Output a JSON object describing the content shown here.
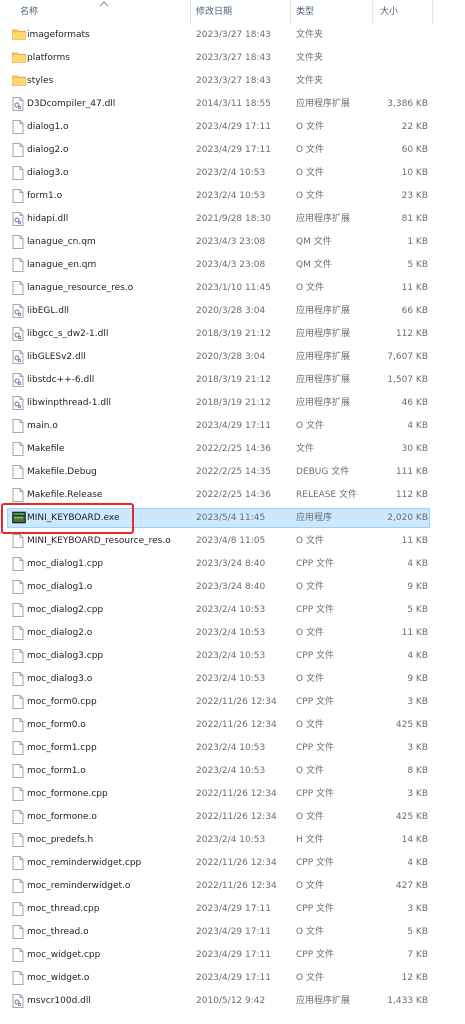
{
  "header": {
    "col_name": "名称",
    "col_date": "修改日期",
    "col_type": "类型",
    "col_size": "大小"
  },
  "files": [
    {
      "name": "imageformats",
      "date": "2023/3/27 18:43",
      "type": "文件夹",
      "size": "",
      "icon": "folder-icon"
    },
    {
      "name": "platforms",
      "date": "2023/3/27 18:43",
      "type": "文件夹",
      "size": "",
      "icon": "folder-icon"
    },
    {
      "name": "styles",
      "date": "2023/3/27 18:43",
      "type": "文件夹",
      "size": "",
      "icon": "folder-icon"
    },
    {
      "name": "D3Dcompiler_47.dll",
      "date": "2014/3/11 18:55",
      "type": "应用程序扩展",
      "size": "3,386 KB",
      "icon": "dll-icon"
    },
    {
      "name": "dialog1.o",
      "date": "2023/4/29 17:11",
      "type": "O 文件",
      "size": "22 KB",
      "icon": "file-icon"
    },
    {
      "name": "dialog2.o",
      "date": "2023/4/29 17:11",
      "type": "O 文件",
      "size": "60 KB",
      "icon": "file-icon"
    },
    {
      "name": "dialog3.o",
      "date": "2023/2/4 10:53",
      "type": "O 文件",
      "size": "10 KB",
      "icon": "file-icon"
    },
    {
      "name": "form1.o",
      "date": "2023/2/4 10:53",
      "type": "O 文件",
      "size": "23 KB",
      "icon": "file-icon"
    },
    {
      "name": "hidapi.dll",
      "date": "2021/9/28 18:30",
      "type": "应用程序扩展",
      "size": "81 KB",
      "icon": "dll-icon"
    },
    {
      "name": "lanague_cn.qm",
      "date": "2023/4/3 23:08",
      "type": "QM 文件",
      "size": "1 KB",
      "icon": "file-icon"
    },
    {
      "name": "lanague_en.qm",
      "date": "2023/4/3 23:08",
      "type": "QM 文件",
      "size": "5 KB",
      "icon": "file-icon"
    },
    {
      "name": "lanague_resource_res.o",
      "date": "2023/1/10 11:45",
      "type": "O 文件",
      "size": "11 KB",
      "icon": "file-icon"
    },
    {
      "name": "libEGL.dll",
      "date": "2020/3/28 3:04",
      "type": "应用程序扩展",
      "size": "66 KB",
      "icon": "dll-icon"
    },
    {
      "name": "libgcc_s_dw2-1.dll",
      "date": "2018/3/19 21:12",
      "type": "应用程序扩展",
      "size": "112 KB",
      "icon": "dll-icon"
    },
    {
      "name": "libGLESv2.dll",
      "date": "2020/3/28 3:04",
      "type": "应用程序扩展",
      "size": "7,607 KB",
      "icon": "dll-icon"
    },
    {
      "name": "libstdc++-6.dll",
      "date": "2018/3/19 21:12",
      "type": "应用程序扩展",
      "size": "1,507 KB",
      "icon": "dll-icon"
    },
    {
      "name": "libwinpthread-1.dll",
      "date": "2018/3/19 21:12",
      "type": "应用程序扩展",
      "size": "46 KB",
      "icon": "dll-icon"
    },
    {
      "name": "main.o",
      "date": "2023/4/29 17:11",
      "type": "O 文件",
      "size": "4 KB",
      "icon": "file-icon"
    },
    {
      "name": "Makefile",
      "date": "2022/2/25 14:36",
      "type": "文件",
      "size": "30 KB",
      "icon": "file-icon"
    },
    {
      "name": "Makefile.Debug",
      "date": "2022/2/25 14:35",
      "type": "DEBUG 文件",
      "size": "111 KB",
      "icon": "file-icon"
    },
    {
      "name": "Makefile.Release",
      "date": "2022/2/25 14:36",
      "type": "RELEASE 文件",
      "size": "112 KB",
      "icon": "file-icon"
    },
    {
      "name": "MINI_KEYBOARD.exe",
      "date": "2023/5/4 11:45",
      "type": "应用程序",
      "size": "2,020 KB",
      "icon": "exe-icon",
      "selected": true
    },
    {
      "name": "MINI_KEYBOARD_resource_res.o",
      "date": "2023/4/8 11:05",
      "type": "O 文件",
      "size": "11 KB",
      "icon": "file-icon"
    },
    {
      "name": "moc_dialog1.cpp",
      "date": "2023/3/24 8:40",
      "type": "CPP 文件",
      "size": "4 KB",
      "icon": "file-icon"
    },
    {
      "name": "moc_dialog1.o",
      "date": "2023/3/24 8:40",
      "type": "O 文件",
      "size": "9 KB",
      "icon": "file-icon"
    },
    {
      "name": "moc_dialog2.cpp",
      "date": "2023/2/4 10:53",
      "type": "CPP 文件",
      "size": "5 KB",
      "icon": "file-icon"
    },
    {
      "name": "moc_dialog2.o",
      "date": "2023/2/4 10:53",
      "type": "O 文件",
      "size": "11 KB",
      "icon": "file-icon"
    },
    {
      "name": "moc_dialog3.cpp",
      "date": "2023/2/4 10:53",
      "type": "CPP 文件",
      "size": "4 KB",
      "icon": "file-icon"
    },
    {
      "name": "moc_dialog3.o",
      "date": "2023/2/4 10:53",
      "type": "O 文件",
      "size": "9 KB",
      "icon": "file-icon"
    },
    {
      "name": "moc_form0.cpp",
      "date": "2022/11/26 12:34",
      "type": "CPP 文件",
      "size": "3 KB",
      "icon": "file-icon"
    },
    {
      "name": "moc_form0.o",
      "date": "2022/11/26 12:34",
      "type": "O 文件",
      "size": "425 KB",
      "icon": "file-icon"
    },
    {
      "name": "moc_form1.cpp",
      "date": "2023/2/4 10:53",
      "type": "CPP 文件",
      "size": "3 KB",
      "icon": "file-icon"
    },
    {
      "name": "moc_form1.o",
      "date": "2023/2/4 10:53",
      "type": "O 文件",
      "size": "8 KB",
      "icon": "file-icon"
    },
    {
      "name": "moc_formone.cpp",
      "date": "2022/11/26 12:34",
      "type": "CPP 文件",
      "size": "3 KB",
      "icon": "file-icon"
    },
    {
      "name": "moc_formone.o",
      "date": "2022/11/26 12:34",
      "type": "O 文件",
      "size": "425 KB",
      "icon": "file-icon"
    },
    {
      "name": "moc_predefs.h",
      "date": "2023/2/4 10:53",
      "type": "H 文件",
      "size": "14 KB",
      "icon": "file-icon"
    },
    {
      "name": "moc_reminderwidget.cpp",
      "date": "2022/11/26 12:34",
      "type": "CPP 文件",
      "size": "4 KB",
      "icon": "file-icon"
    },
    {
      "name": "moc_reminderwidget.o",
      "date": "2022/11/26 12:34",
      "type": "O 文件",
      "size": "427 KB",
      "icon": "file-icon"
    },
    {
      "name": "moc_thread.cpp",
      "date": "2023/4/29 17:11",
      "type": "CPP 文件",
      "size": "3 KB",
      "icon": "file-icon"
    },
    {
      "name": "moc_thread.o",
      "date": "2023/4/29 17:11",
      "type": "O 文件",
      "size": "5 KB",
      "icon": "file-icon"
    },
    {
      "name": "moc_widget.cpp",
      "date": "2023/4/29 17:11",
      "type": "CPP 文件",
      "size": "7 KB",
      "icon": "file-icon"
    },
    {
      "name": "moc_widget.o",
      "date": "2023/4/29 17:11",
      "type": "O 文件",
      "size": "12 KB",
      "icon": "file-icon"
    },
    {
      "name": "msvcr100d.dll",
      "date": "2010/5/12 9:42",
      "type": "应用程序扩展",
      "size": "1,433 KB",
      "icon": "dll-icon"
    }
  ]
}
